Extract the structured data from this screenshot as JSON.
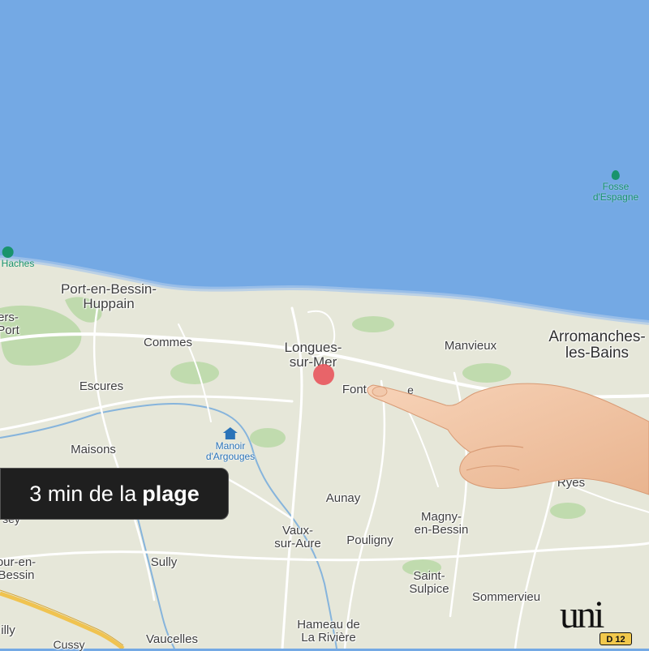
{
  "map": {
    "sea_color": "#74a9e4",
    "land_color": "#e6e7d9",
    "sea_pois": [
      {
        "name": "Fosse d'Espagne",
        "line1": "Fosse",
        "line2": "d'Espagne"
      },
      {
        "name": "Haches",
        "line1": "Haches"
      }
    ],
    "places": {
      "port_en_bessin": {
        "line1": "Port-en-Bessin-",
        "line2": "Huppain"
      },
      "vers_port": {
        "line1": "ers-",
        "line2": "Port"
      },
      "commes": "Commes",
      "longues": {
        "line1": "Longues-",
        "line2": "sur-Mer"
      },
      "manvieux": "Manvieux",
      "arromanches": {
        "line1": "Arromanches-",
        "line2": "les-Bains"
      },
      "escures": "Escures",
      "fontenailles": "Fonte",
      "fontenailles_tail": "e",
      "maisons": "Maisons",
      "ryes": "Ryes",
      "aunay": "Aunay",
      "magny": {
        "line1": "Magny-",
        "line2": "en-Bessin"
      },
      "vaux": {
        "line1": "Vaux-",
        "line2": "sur-Aure"
      },
      "pouligny": "Pouligny",
      "sully": "Sully",
      "tour_en_bessin": {
        "line1": "our-en-",
        "line2": "Bessin"
      },
      "saint_sulpice": {
        "line1": "Saint-",
        "line2": "Sulpice"
      },
      "sommervieu": "Sommervieu",
      "hameau": {
        "line1": "Hameau de",
        "line2": "La Rivière"
      },
      "vaucelles": "Vaucelles",
      "cussy": "Cussy",
      "tilly": "illy",
      "bayeux_edge": "sey"
    },
    "land_poi": {
      "name": "Manoir d'Argouges",
      "line1": "Manoir",
      "line2": "d'Argouges"
    },
    "marker_color": "#e8595f"
  },
  "badge": {
    "prefix": "3 min de la",
    "bold": "plage"
  },
  "brand": {
    "logo": "uni",
    "tag": "D 12",
    "tag_color": "#f1c84c"
  }
}
